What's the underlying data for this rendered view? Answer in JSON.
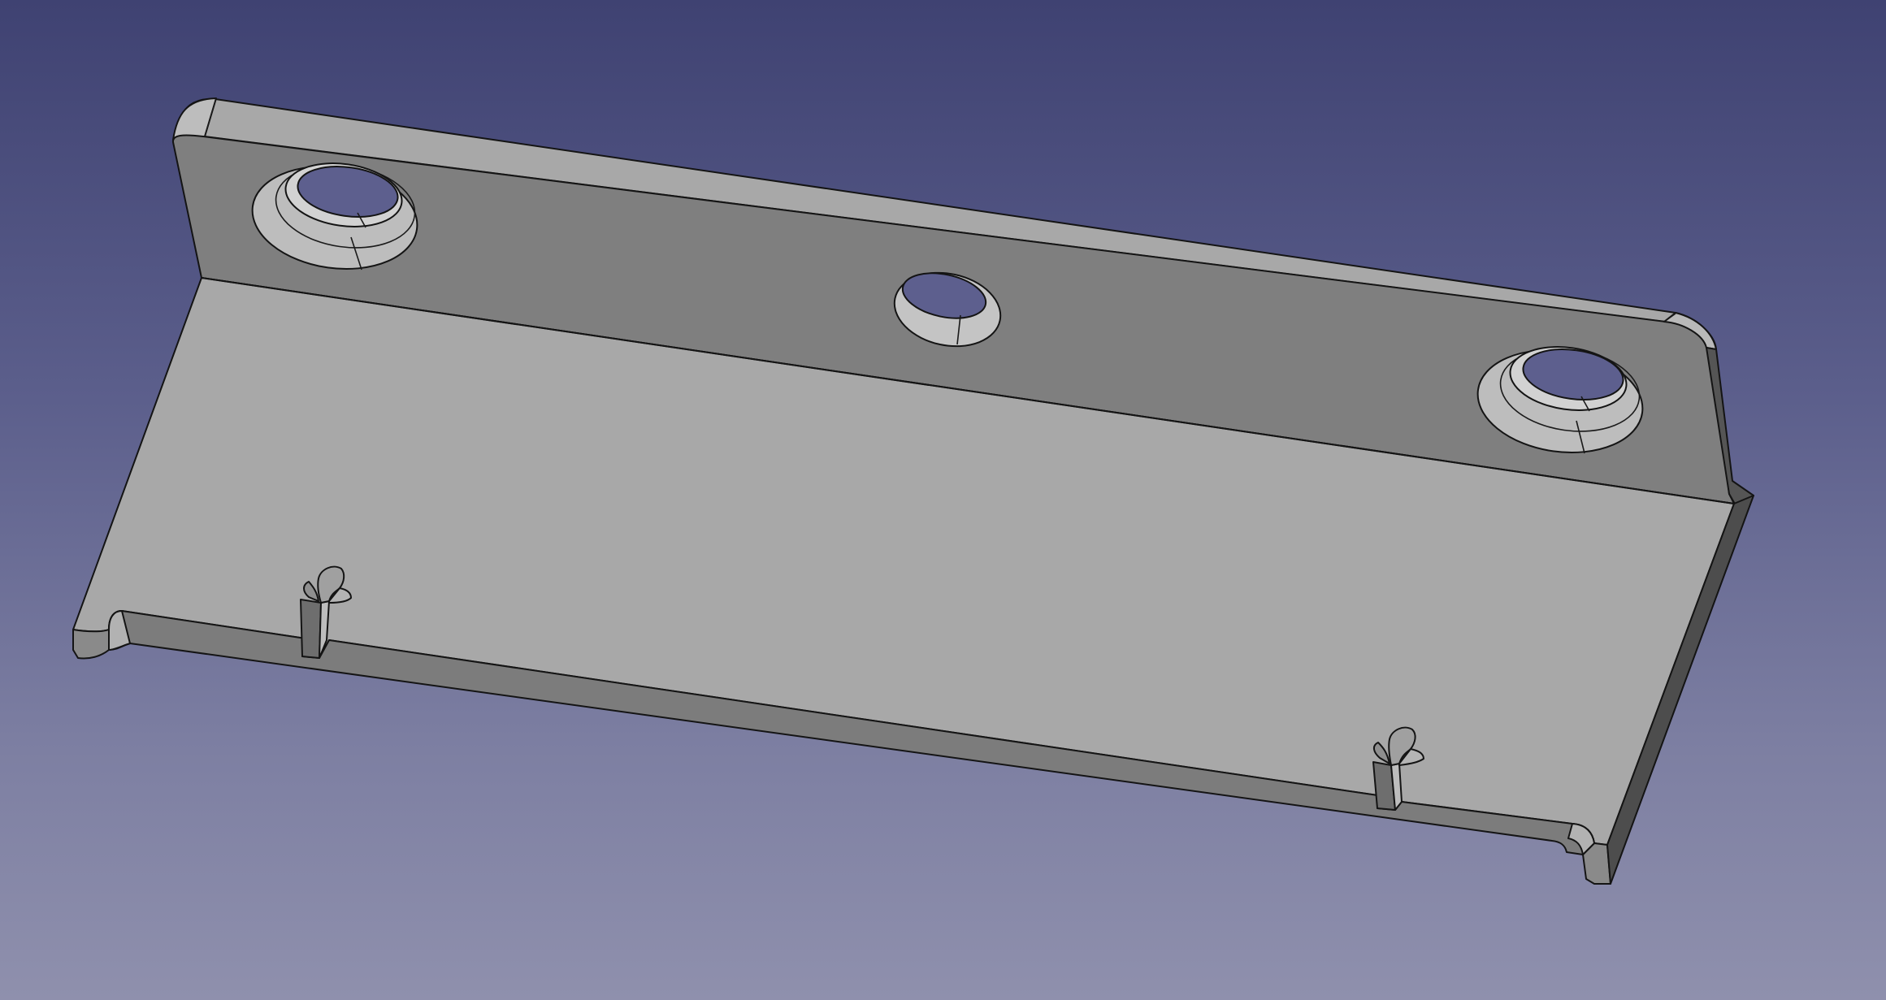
{
  "viewport": {
    "background_top": "#3f4272",
    "background_bottom": "#8f90ad"
  },
  "model": {
    "shape": "l-bracket",
    "holes_in_upright": 3,
    "slots_in_base": 2,
    "face_colors": {
      "top_light": "#a9a9a9",
      "front_dark": "#7f7f7f",
      "edge_side": "#4a4a4a",
      "outline": "#141414"
    }
  }
}
